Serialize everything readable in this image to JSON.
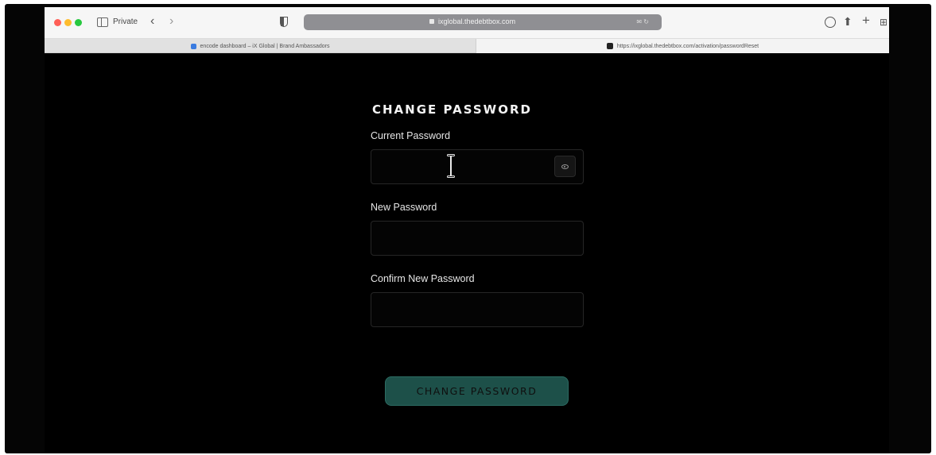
{
  "browser": {
    "private_label": "Private",
    "back_glyph": "‹",
    "forward_glyph": "›",
    "address_url": "ixglobal.thedebtbox.com",
    "address_extra": "✉ ↻",
    "share_glyph": "⬆",
    "plus_glyph": "+",
    "grid_glyph": "⊞",
    "tabs": [
      {
        "title": "encode dashboard – iX Global | Brand Ambassadors",
        "favicon": "ix-logo-icon"
      },
      {
        "title": "https://ixglobal.thedebtbox.com/activation/passwordReset",
        "favicon": "debtbox-favicon-icon"
      }
    ],
    "colors": {
      "close": "#ff5f57",
      "minimize": "#febc2e",
      "zoom": "#28c840"
    }
  },
  "form": {
    "title": "CHANGE PASSWORD",
    "current_password": {
      "label": "Current Password",
      "value": ""
    },
    "new_password": {
      "label": "New Password",
      "value": ""
    },
    "confirm_password": {
      "label": "Confirm New Password",
      "value": ""
    },
    "toggle_icon": "eye-icon",
    "submit_label": "CHANGE PASSWORD",
    "colors": {
      "background": "#000000",
      "button": "#1d5049",
      "button_text": "#0f0f0f"
    }
  }
}
